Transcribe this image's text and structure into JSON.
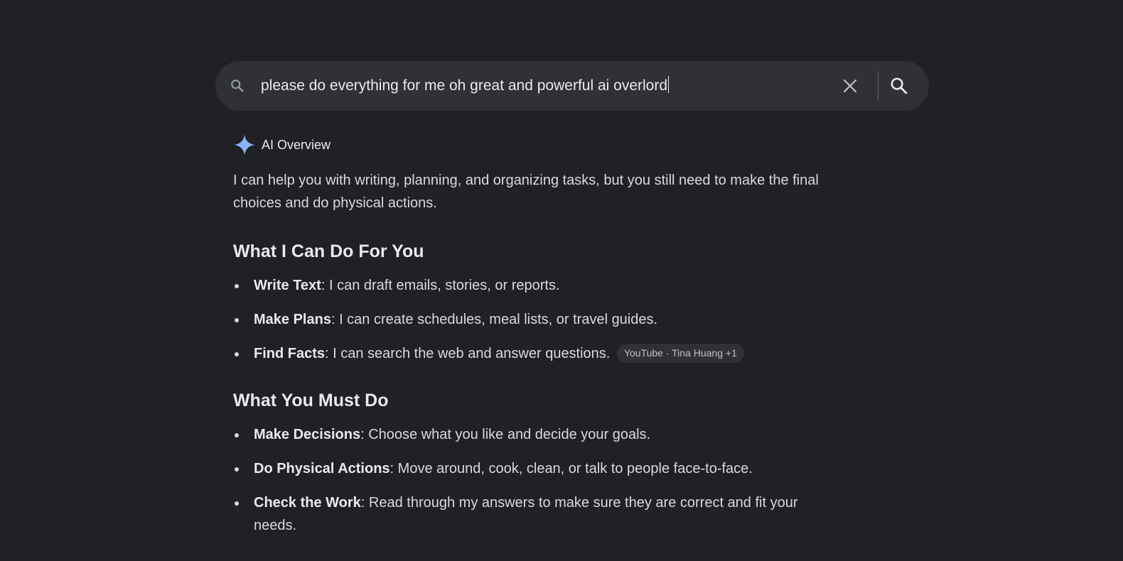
{
  "search": {
    "query": "please do everything for me oh great and powerful ai overlord"
  },
  "ai_overview": {
    "label": "AI Overview",
    "intro": "I can help you with writing, planning, and organizing tasks, but you still need to make the final choices and do physical actions.",
    "sections": [
      {
        "heading": "What I Can Do For You",
        "items": [
          {
            "title": "Write Text",
            "text": ": I can draft emails, stories, or reports."
          },
          {
            "title": "Make Plans",
            "text": ": I can create schedules, meal lists, or travel guides."
          },
          {
            "title": "Find Facts",
            "text": ": I can search the web and answer questions.",
            "source": "YouTube · Tina Huang +1"
          }
        ]
      },
      {
        "heading": "What You Must Do",
        "items": [
          {
            "title": "Make Decisions",
            "text": ": Choose what you like and decide your goals."
          },
          {
            "title": "Do Physical Actions",
            "text": ": Move around, cook, clean, or talk to people face-to-face."
          },
          {
            "title": "Check the Work",
            "text": ": Read through my answers to make sure they are correct and fit your needs."
          }
        ]
      }
    ]
  },
  "icons": {
    "search_leading": "search-icon",
    "clear": "close-icon",
    "search_submit": "search-icon",
    "ai": "sparkle-icon"
  },
  "colors": {
    "background": "#202124",
    "search_bar": "#303134",
    "text": "#e8eaed",
    "sparkle": "#8ab4f8"
  }
}
